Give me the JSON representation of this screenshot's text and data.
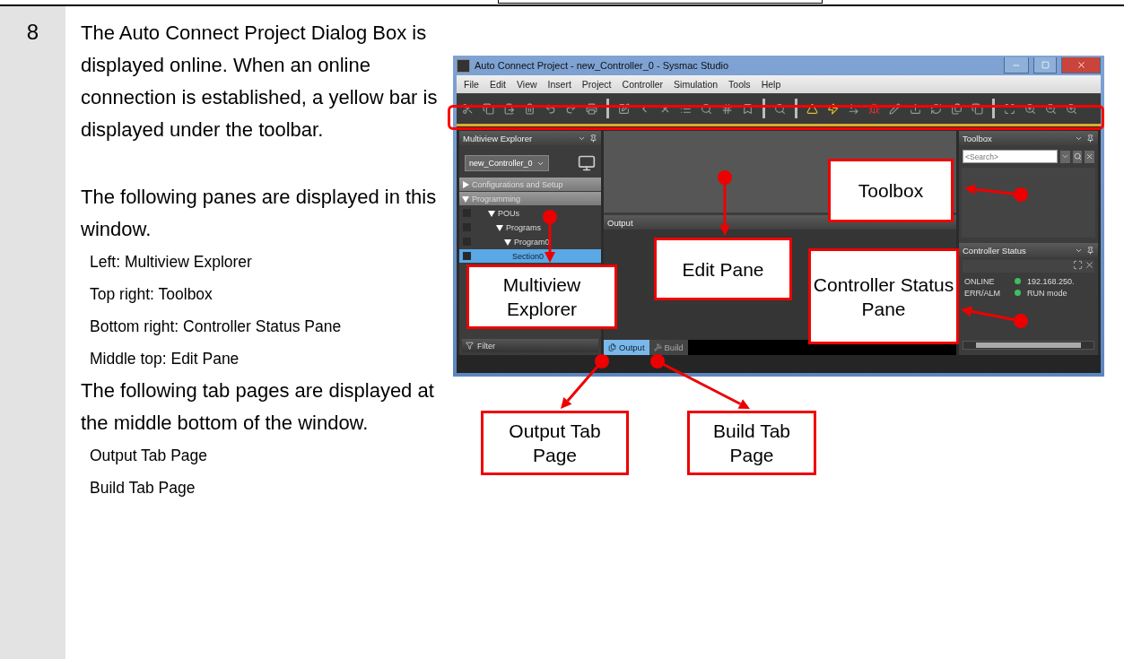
{
  "step": {
    "number": "8",
    "sections": [
      {
        "blocks": [
          {
            "kind": "paragraph",
            "text": "The Auto Connect Project Dialog Box is displayed online. When an online connection is established, a yellow bar is displayed under the toolbar."
          }
        ]
      },
      {
        "blocks": [
          {
            "kind": "paragraph",
            "text": "The following panes are displayed in this window."
          },
          {
            "kind": "item",
            "text": "Left: Multiview Explorer"
          },
          {
            "kind": "item",
            "text": "Top right: Toolbox"
          },
          {
            "kind": "item",
            "text": "Bottom right: Controller Status Pane"
          },
          {
            "kind": "item",
            "text": "Middle top: Edit Pane"
          },
          {
            "kind": "paragraph",
            "text": "The following tab pages are displayed at the middle bottom of the window."
          },
          {
            "kind": "item",
            "text": "Output Tab Page"
          },
          {
            "kind": "item",
            "text": "Build Tab Page"
          }
        ]
      }
    ]
  },
  "window": {
    "title": "Auto Connect Project - new_Controller_0 - Sysmac Studio",
    "menu": [
      "File",
      "Edit",
      "View",
      "Insert",
      "Project",
      "Controller",
      "Simulation",
      "Tools",
      "Help"
    ],
    "online": true
  },
  "explorer": {
    "title": "Multiview Explorer",
    "controller": "new_Controller_0",
    "filter": "Filter",
    "tree": [
      {
        "label": "Configurations and Setup",
        "expanded": false,
        "selected": false
      },
      {
        "label": "Programming",
        "expanded": true,
        "selected": false,
        "children": [
          {
            "label": "POUs",
            "expanded": true,
            "selected": false,
            "children": [
              {
                "label": "Programs",
                "expanded": true,
                "selected": false,
                "children": [
                  {
                    "label": "Program0",
                    "expanded": true,
                    "selected": false,
                    "children": [
                      {
                        "label": "Section0",
                        "selected": true
                      }
                    ]
                  }
                ]
              }
            ]
          }
        ]
      }
    ]
  },
  "output": {
    "title": "Output",
    "tabs": [
      {
        "label": "Output",
        "selected": true
      },
      {
        "label": "Build",
        "selected": false
      }
    ]
  },
  "toolbox": {
    "title": "Toolbox",
    "placeholder": "<Search>"
  },
  "controller_status": {
    "title": "Controller Status",
    "rows": [
      {
        "label": "ONLINE",
        "color": "#3cc060",
        "value": "192.168.250."
      },
      {
        "label": "ERR/ALM",
        "color": "#3cc060",
        "value": "RUN mode"
      }
    ]
  },
  "callouts": [
    {
      "kind": "toolbox",
      "text": "Toolbox"
    },
    {
      "kind": "edit",
      "text": "Edit Pane"
    },
    {
      "kind": "explorer",
      "text": "Multiview Explorer"
    },
    {
      "kind": "status",
      "text": "Controller Status Pane"
    },
    {
      "kind": "output",
      "text": "Output Tab Page"
    },
    {
      "kind": "build",
      "text": "Build Tab Page"
    }
  ]
}
